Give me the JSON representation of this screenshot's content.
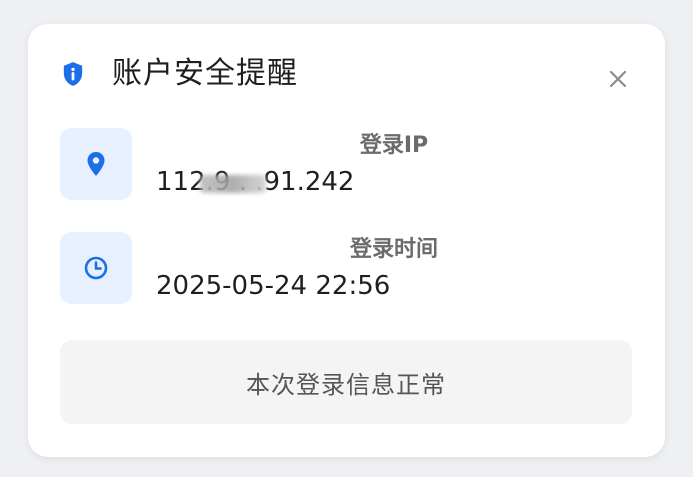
{
  "dialog": {
    "title": "账户安全提醒",
    "shield_icon": "shield-info-icon",
    "close_icon": "close-icon"
  },
  "login_ip": {
    "label": "登录IP",
    "value": "112.9 .  .91.242",
    "icon": "location-pin-icon"
  },
  "login_time": {
    "label": "登录时间",
    "value": "2025-05-24 22:56",
    "icon": "clock-icon"
  },
  "status": {
    "text": "本次登录信息正常"
  },
  "colors": {
    "accent": "#1e6ee8",
    "icon_bg": "#e6f0ff",
    "status_bg": "#f4f4f4"
  }
}
